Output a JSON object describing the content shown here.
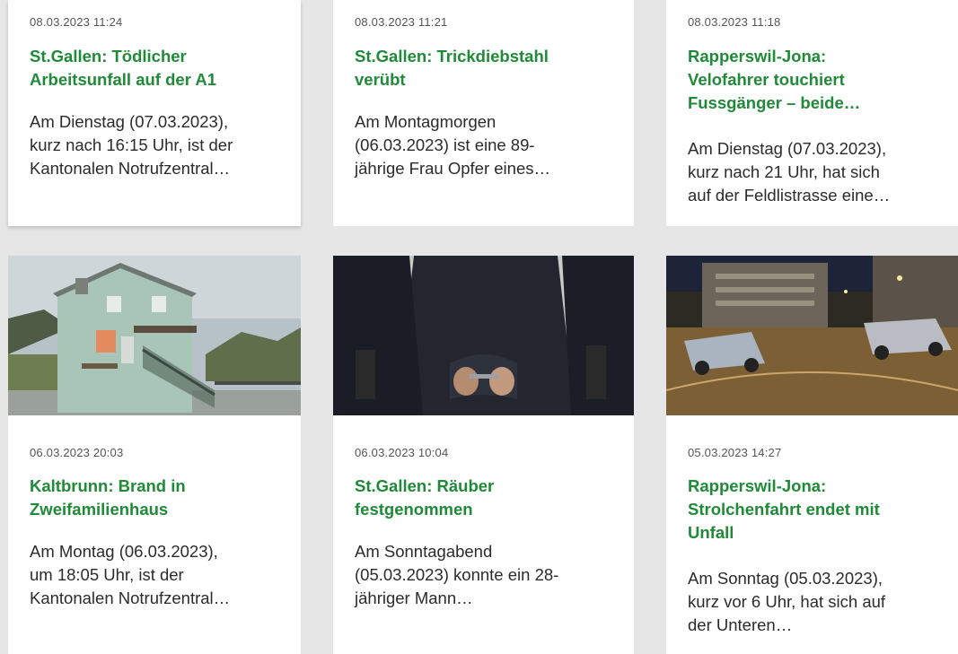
{
  "articles": [
    {
      "date": "08.03.2023 11:24",
      "title_lines": [
        "St.Gallen: Tödlicher",
        "Arbeitsunfall auf der A1"
      ],
      "teaser_lines": [
        "Am Dienstag (07.03.2023),",
        "kurz nach 16:15 Uhr, ist der",
        "Kantonalen Notrufzentral…"
      ]
    },
    {
      "date": "08.03.2023 11:21",
      "title_lines": [
        "St.Gallen: Trickdiebstahl",
        "verübt"
      ],
      "teaser_lines": [
        "Am Montagmorgen",
        "(06.03.2023) ist eine 89-",
        "jährige Frau Opfer eines…"
      ]
    },
    {
      "date": "08.03.2023 11:18",
      "title_lines": [
        "Rapperswil-Jona:",
        "Velofahrer touchiert",
        "Fussgänger – beide…"
      ],
      "teaser_lines": [
        "Am Dienstag (07.03.2023),",
        "kurz nach 21 Uhr, hat sich",
        "auf der Feldlistrasse eine…"
      ]
    },
    {
      "date": "06.03.2023 20:03",
      "title_lines": [
        "Kaltbrunn: Brand in",
        "Zweifamilienhaus"
      ],
      "teaser_lines": [
        "Am Montag (06.03.2023),",
        "um 18:05 Uhr, ist der",
        "Kantonalen Notrufzentral…"
      ]
    },
    {
      "date": "06.03.2023 10:04",
      "title_lines": [
        "St.Gallen: Räuber",
        "festgenommen"
      ],
      "teaser_lines": [
        "Am Sonntagabend",
        "(05.03.2023) konnte ein 28-",
        "jähriger Mann…"
      ]
    },
    {
      "date": "05.03.2023 14:27",
      "title_lines": [
        "Rapperswil-Jona:",
        "Strolchenfahrt endet mit",
        "Unfall"
      ],
      "teaser_lines": [
        "Am Sonntag (05.03.2023),",
        "kurz vor 6 Uhr, hat sich auf",
        "der Unteren…"
      ]
    }
  ],
  "colors": {
    "title": "#1f8a37",
    "text": "#2b2b2b",
    "date": "#555555",
    "background": "#e6e6e6"
  }
}
